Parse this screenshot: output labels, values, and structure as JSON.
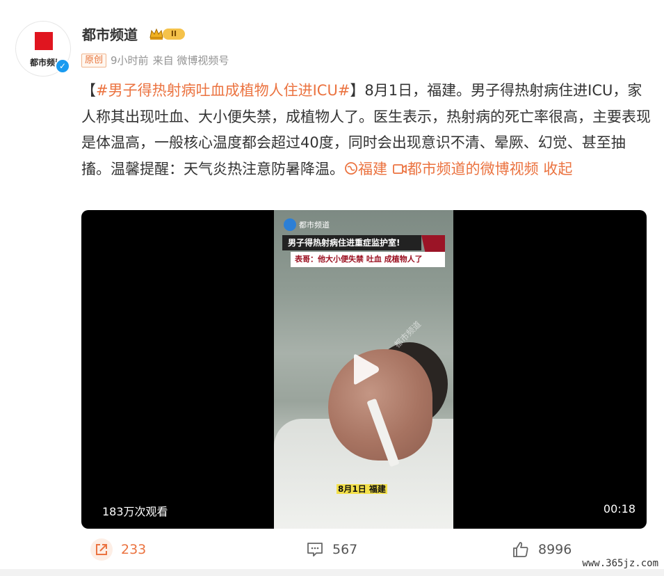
{
  "account": {
    "name": "都市频道",
    "avatar_text": "都市频i",
    "level_badge": "II",
    "icons": {
      "avatar": "red-square-logo",
      "verified": "verified-check-icon",
      "vip": "crown-icon"
    }
  },
  "meta": {
    "original_tag": "原创",
    "time": "9小时前",
    "source": "来自 微博视频号"
  },
  "post": {
    "bracket_open": "【",
    "hashtag": "#男子得热射病吐血成植物人住进ICU#",
    "bracket_close": "】",
    "body": "8月1日，福建。男子得热射病住进ICU，家人称其出现吐血、大小便失禁，成植物人了。医生表示，热射病的死亡率很高，主要表现是体温高，一般核心温度都会超过40度，同时会出现意识不清、晕厥、幻觉、甚至抽搐。温馨提醒：天气炎热注意防暑降温。",
    "location": "福建",
    "video_link": "都市频道的微博视频",
    "collapse": "收起",
    "link_color": "#eb7340"
  },
  "video": {
    "overlay_logo": "都市频道",
    "headline": "男子得热射病住进重症监护室!",
    "subline": "表哥：他大小便失禁 吐血 成植物人了",
    "watermark": "都市频道",
    "date_caption": "8月1日  福建",
    "views": "183万次观看",
    "duration": "00:18"
  },
  "actions": {
    "repost_count": "233",
    "comment_count": "567",
    "like_count": "8996"
  },
  "site_watermark": "www.365jz.com"
}
